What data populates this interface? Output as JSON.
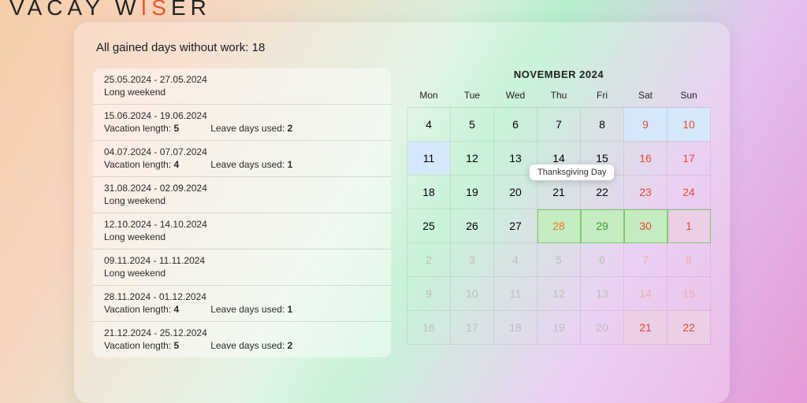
{
  "brand": {
    "pre": "VACAY W",
    "accent": "IS",
    "post": "ER"
  },
  "summary_label": "All gained days without work: ",
  "summary_value": "18",
  "list": [
    {
      "dates": "25.05.2024 - 27.05.2024",
      "sub": "Long weekend"
    },
    {
      "dates": "15.06.2024 - 19.06.2024",
      "len_label": "Vacation length:",
      "len": "5",
      "used_label": "Leave days used:",
      "used": "2"
    },
    {
      "dates": "04.07.2024 - 07.07.2024",
      "len_label": "Vacation length:",
      "len": "4",
      "used_label": "Leave days used:",
      "used": "1"
    },
    {
      "dates": "31.08.2024 - 02.09.2024",
      "sub": "Long weekend"
    },
    {
      "dates": "12.10.2024 - 14.10.2024",
      "sub": "Long weekend"
    },
    {
      "dates": "09.11.2024 - 11.11.2024",
      "sub": "Long weekend"
    },
    {
      "dates": "28.11.2024 - 01.12.2024",
      "len_label": "Vacation length:",
      "len": "4",
      "used_label": "Leave days used:",
      "used": "1"
    },
    {
      "dates": "21.12.2024 - 25.12.2024",
      "len_label": "Vacation length:",
      "len": "5",
      "used_label": "Leave days used:",
      "used": "2"
    }
  ],
  "calendar": {
    "title": "NOVEMBER 2024",
    "dow": [
      "Mon",
      "Tue",
      "Wed",
      "Thu",
      "Fri",
      "Sat",
      "Sun"
    ],
    "tooltip": "Thanksgiving Day",
    "rows": [
      [
        {
          "n": "4"
        },
        {
          "n": "5"
        },
        {
          "n": "6"
        },
        {
          "n": "7"
        },
        {
          "n": "8"
        },
        {
          "n": "9",
          "cls": "wknd blue"
        },
        {
          "n": "10",
          "cls": "wknd blue"
        }
      ],
      [
        {
          "n": "11",
          "cls": "blue"
        },
        {
          "n": "12"
        },
        {
          "n": "13"
        },
        {
          "n": "14"
        },
        {
          "n": "15"
        },
        {
          "n": "16",
          "cls": "wknd"
        },
        {
          "n": "17",
          "cls": "wknd"
        }
      ],
      [
        {
          "n": "18"
        },
        {
          "n": "19"
        },
        {
          "n": "20"
        },
        {
          "n": "21",
          "tip": true
        },
        {
          "n": "22"
        },
        {
          "n": "23",
          "cls": "wknd"
        },
        {
          "n": "24",
          "cls": "wknd"
        }
      ],
      [
        {
          "n": "25"
        },
        {
          "n": "26"
        },
        {
          "n": "27"
        },
        {
          "n": "28",
          "cls": "orange green greenbox"
        },
        {
          "n": "29",
          "cls": "green greenbox",
          "style": "color:#3a9a3a"
        },
        {
          "n": "30",
          "cls": "wknd green greenbox"
        },
        {
          "n": "1",
          "cls": "wknd green greenbox pinkcell"
        }
      ],
      [
        {
          "n": "2",
          "cls": "muted"
        },
        {
          "n": "3",
          "cls": "muted"
        },
        {
          "n": "4",
          "cls": "muted"
        },
        {
          "n": "5",
          "cls": "muted"
        },
        {
          "n": "6",
          "cls": "muted"
        },
        {
          "n": "7",
          "cls": "muted wknd",
          "style": "color:#e7b1aa"
        },
        {
          "n": "8",
          "cls": "muted wknd",
          "style": "color:#e7b1aa"
        }
      ],
      [
        {
          "n": "9",
          "cls": "muted"
        },
        {
          "n": "10",
          "cls": "muted"
        },
        {
          "n": "11",
          "cls": "muted"
        },
        {
          "n": "12",
          "cls": "muted"
        },
        {
          "n": "13",
          "cls": "muted"
        },
        {
          "n": "14",
          "cls": "muted wknd",
          "style": "color:#e7b1aa"
        },
        {
          "n": "15",
          "cls": "muted wknd",
          "style": "color:#e7b1aa"
        }
      ],
      [
        {
          "n": "16",
          "cls": "muted"
        },
        {
          "n": "17",
          "cls": "muted"
        },
        {
          "n": "18",
          "cls": "muted"
        },
        {
          "n": "19",
          "cls": "muted"
        },
        {
          "n": "20",
          "cls": "muted"
        },
        {
          "n": "21",
          "cls": "wknd pinkcell"
        },
        {
          "n": "22",
          "cls": "wknd pinkcell"
        }
      ]
    ]
  }
}
